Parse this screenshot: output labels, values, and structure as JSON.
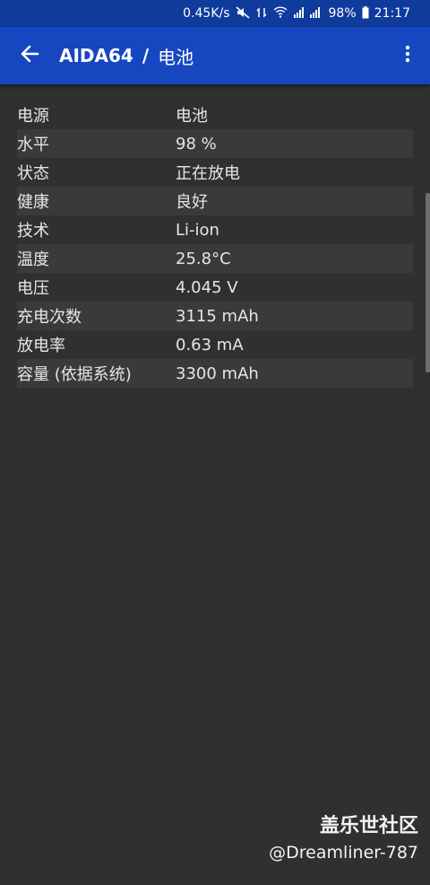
{
  "status_bar": {
    "net_speed": "0.45K/s",
    "battery": "98%",
    "time": "21:17"
  },
  "app_bar": {
    "app_name": "AIDA64",
    "separator": "/",
    "page_title": "电池"
  },
  "rows": [
    {
      "key": "电源",
      "value": "电池"
    },
    {
      "key": "水平",
      "value": "98 %"
    },
    {
      "key": "状态",
      "value": "正在放电"
    },
    {
      "key": "健康",
      "value": "良好"
    },
    {
      "key": "技术",
      "value": "Li-ion"
    },
    {
      "key": "温度",
      "value": "25.8°C"
    },
    {
      "key": "电压",
      "value": "4.045 V"
    },
    {
      "key": "充电次数",
      "value": "3115 mAh"
    },
    {
      "key": "放电率",
      "value": "0.63 mA"
    },
    {
      "key": "容量 (依据系统)",
      "value": "3300 mAh"
    }
  ],
  "watermark": {
    "brand": "盖乐世社区",
    "user": "@Dreamliner-787"
  },
  "colors": {
    "app_bar": "#1646c0",
    "status_bar": "#0f3b9c",
    "background": "#303030",
    "row_alt": "#3a3a3a"
  }
}
